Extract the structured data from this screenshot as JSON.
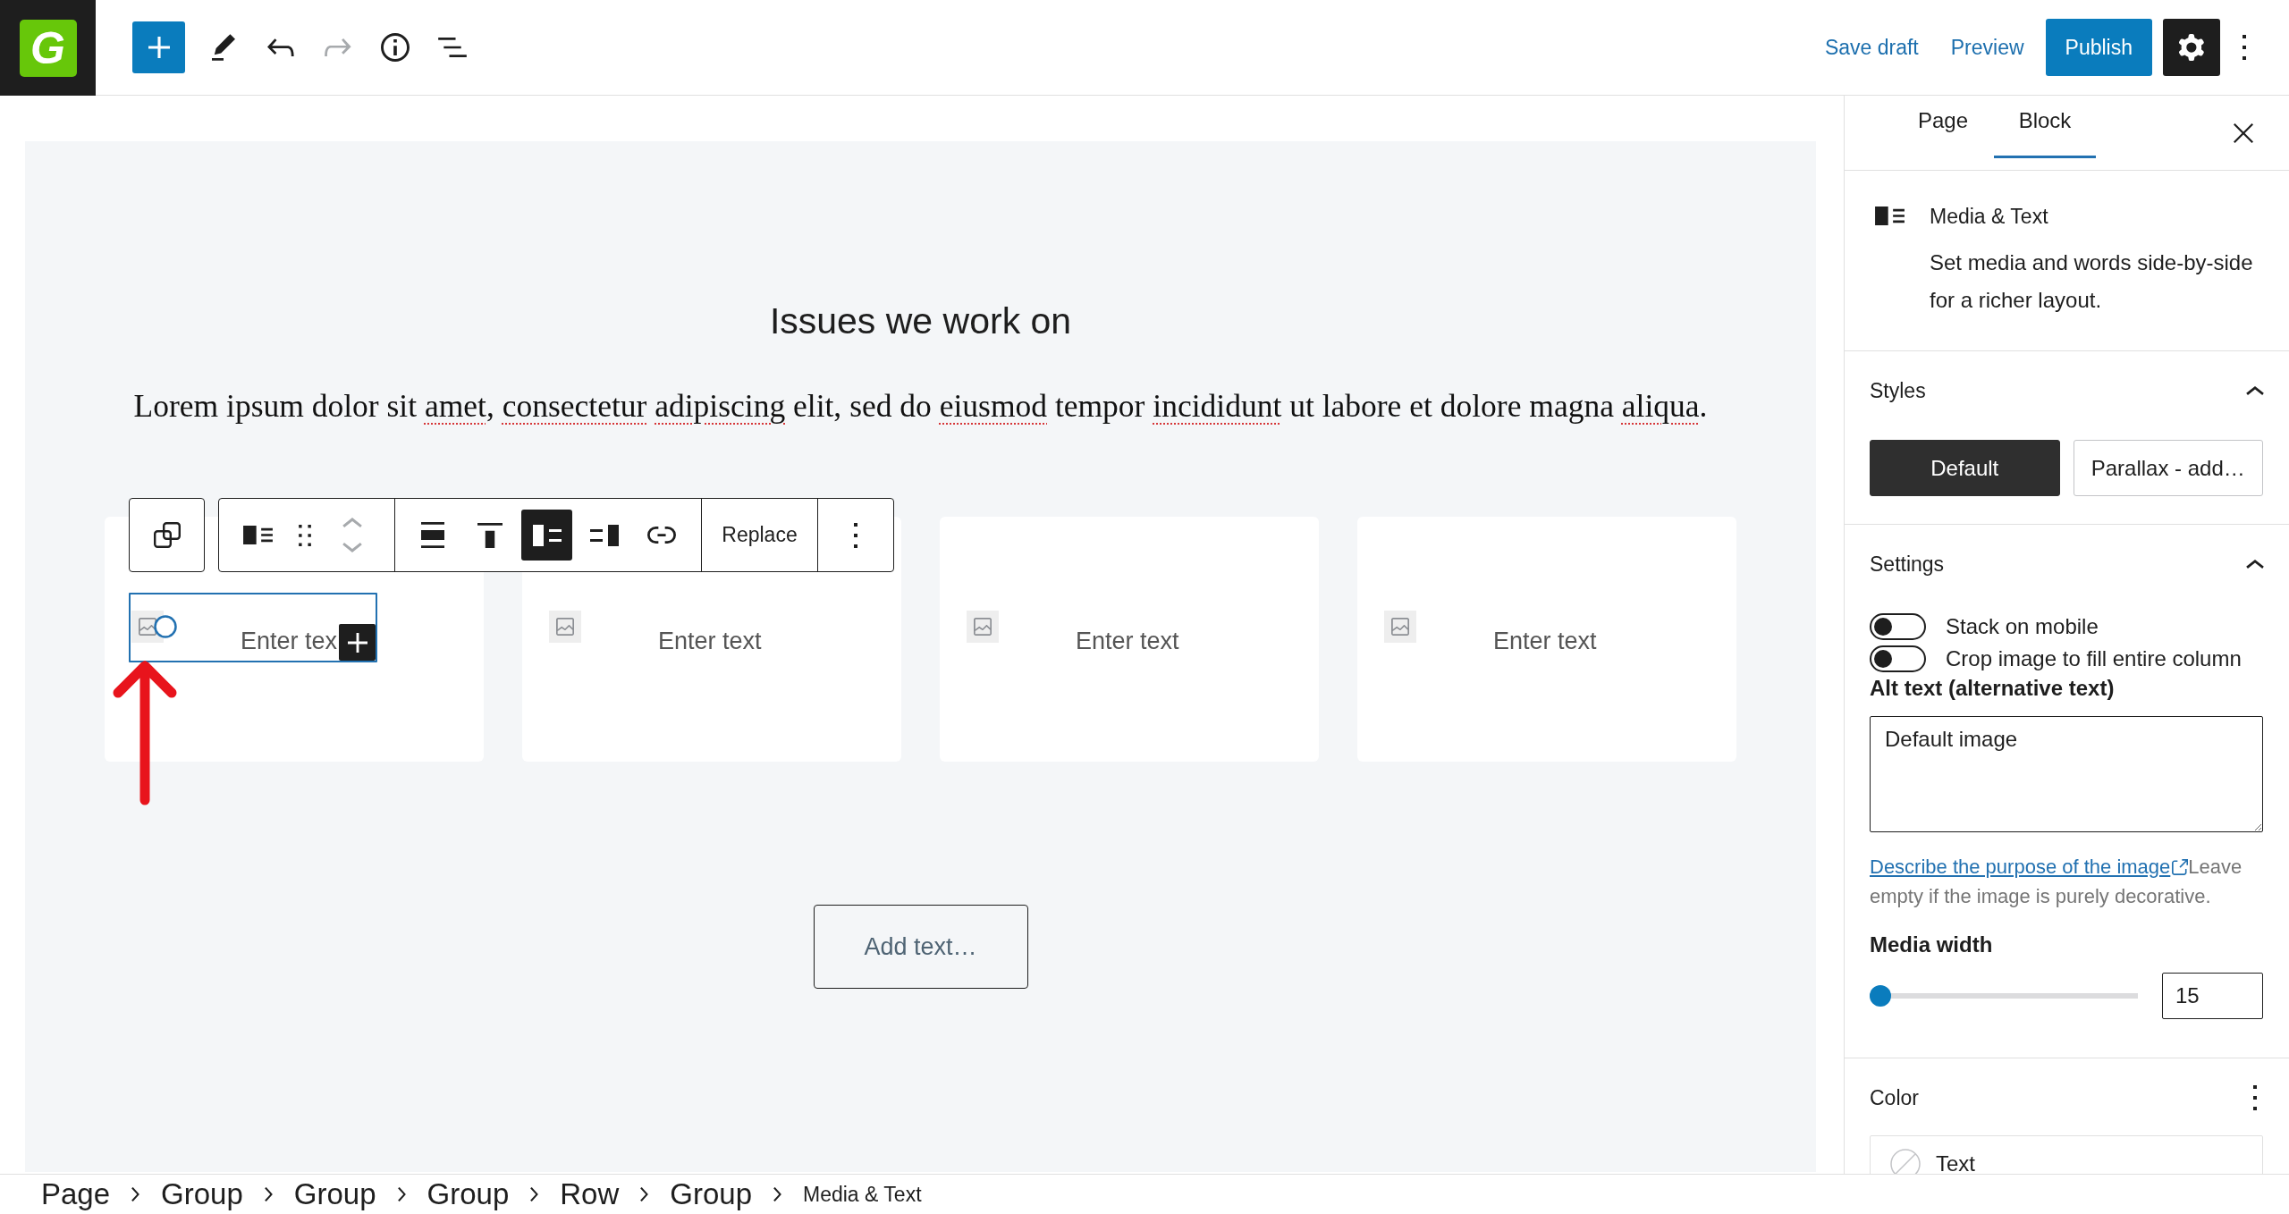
{
  "top_bar": {
    "logo": {
      "letter": "G"
    },
    "tools": [
      {
        "kind": "add",
        "disabled": false
      },
      {
        "kind": "edit",
        "disabled": false
      },
      {
        "kind": "undo",
        "disabled": false
      },
      {
        "kind": "redo",
        "disabled": true
      },
      {
        "kind": "info",
        "disabled": false
      },
      {
        "kind": "list",
        "disabled": false
      }
    ],
    "save_draft": "Save draft",
    "preview": "Preview",
    "publish": "Publish",
    "settings": {
      "pressed": true
    }
  },
  "canvas": {
    "heading": "Issues we work on",
    "paragraph": {
      "segments": [
        {
          "text": "Lorem ipsum dolor sit ",
          "flagged": false
        },
        {
          "text": "amet",
          "flagged": true
        },
        {
          "text": ", ",
          "flagged": false
        },
        {
          "text": "consectetur adipiscing",
          "flagged": true
        },
        {
          "text": " elit, sed do ",
          "flagged": false
        },
        {
          "text": "eiusmod",
          "flagged": true
        },
        {
          "text": " tempor ",
          "flagged": false
        },
        {
          "text": "incididunt",
          "flagged": true
        },
        {
          "text": " ut labore et dolore magna ",
          "flagged": false
        },
        {
          "text": "aliqua",
          "flagged": true
        },
        {
          "text": ".",
          "flagged": false
        }
      ]
    },
    "block_toolbar": {
      "buttons": [
        {
          "kind": "align",
          "selected": false
        },
        {
          "kind": "valign",
          "selected": false
        },
        {
          "kind": "left",
          "selected": true
        },
        {
          "kind": "right",
          "selected": false
        },
        {
          "kind": "link",
          "selected": false
        }
      ],
      "replace": "Replace"
    },
    "cards": [
      {
        "text": "Enter tex",
        "selected": true
      },
      {
        "text": "Enter text",
        "selected": false
      },
      {
        "text": "Enter text",
        "selected": false
      },
      {
        "text": "Enter text",
        "selected": false
      }
    ],
    "add_text": "Add text…"
  },
  "sidebar": {
    "tabs": [
      {
        "label": "Page",
        "selected": false
      },
      {
        "label": "Block",
        "selected": true
      }
    ],
    "block_card": {
      "title": "Media & Text",
      "description": "Set media and words side-by-side for a richer layout."
    },
    "styles": {
      "title": "Styles",
      "expanded": true,
      "options": [
        {
          "label": "Default",
          "selected": true
        },
        {
          "label": "Parallax - add…",
          "selected": false
        }
      ]
    },
    "settings": {
      "title": "Settings",
      "expanded": true,
      "toggles": [
        {
          "label": "Stack on mobile",
          "on": false
        },
        {
          "label": "Crop image to fill entire column",
          "on": false
        }
      ],
      "alt_text": {
        "label": "Alt text (alternative text)",
        "value": "Default image"
      },
      "help": {
        "link": "Describe the purpose of the image",
        "text": "Leave empty if the image is purely decorative."
      },
      "media_width": {
        "label": "Media width",
        "level": 0,
        "value": "15"
      }
    },
    "color": {
      "title": "Color",
      "items": [
        {
          "label": "Text"
        }
      ]
    }
  },
  "breadcrumbs": [
    {
      "label": "Page",
      "current": false
    },
    {
      "label": "Group",
      "current": false
    },
    {
      "label": "Group",
      "current": false
    },
    {
      "label": "Group",
      "current": false
    },
    {
      "label": "Row",
      "current": false
    },
    {
      "label": "Group",
      "current": false
    },
    {
      "label": "Media & Text",
      "current": true
    }
  ]
}
